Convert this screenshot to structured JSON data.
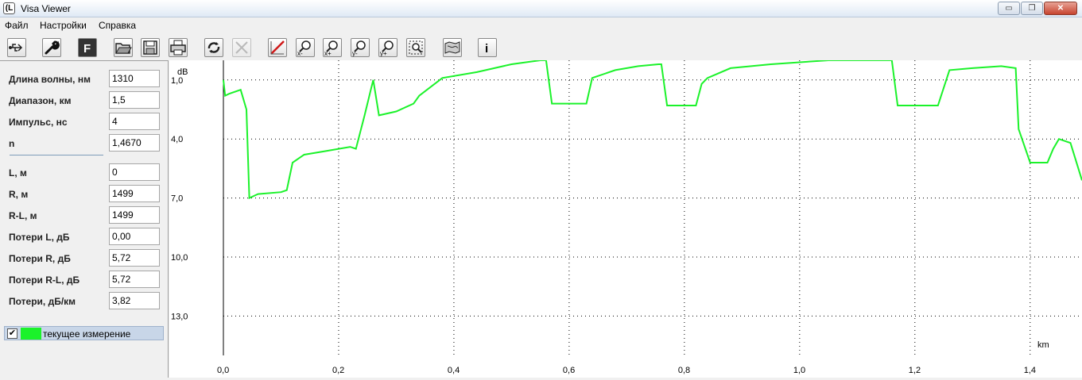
{
  "window": {
    "title": "Visa Viewer",
    "icon_glyph": "(L"
  },
  "window_controls": {
    "minimize": "▭",
    "maximize": "❐",
    "close": "✕"
  },
  "menu": {
    "items": [
      "Файл",
      "Настройки",
      "Справка"
    ]
  },
  "toolbar": {
    "buttons": [
      {
        "icon": "usb-icon"
      },
      {
        "icon": "wrench-icon"
      },
      {
        "icon": "f-icon",
        "label": "F"
      },
      {
        "icon": "folder-open-icon"
      },
      {
        "icon": "save-icon"
      },
      {
        "icon": "print-icon"
      },
      {
        "icon": "refresh-icon"
      },
      {
        "icon": "close-icon",
        "disabled": true
      },
      {
        "icon": "marker-icon"
      },
      {
        "icon": "zoom-x-out-icon",
        "label": "x-"
      },
      {
        "icon": "zoom-x-in-icon",
        "label": "x+"
      },
      {
        "icon": "zoom-y-out-icon",
        "label": "y-"
      },
      {
        "icon": "zoom-y-in-icon",
        "label": "y+"
      },
      {
        "icon": "zoom-fit-icon"
      },
      {
        "icon": "map-icon"
      },
      {
        "icon": "info-icon",
        "label": "i"
      }
    ]
  },
  "params": {
    "wavelength": {
      "label": "Длина волны, нм",
      "value": "1310"
    },
    "range": {
      "label": "Диапазон, км",
      "value": "1,5"
    },
    "pulse": {
      "label": "Импульс, нс",
      "value": "4"
    },
    "n": {
      "label": "n",
      "value": "1,4670"
    },
    "L": {
      "label": "L, м",
      "value": "0"
    },
    "R": {
      "label": "R, м",
      "value": "1499"
    },
    "RL": {
      "label": "R-L, м",
      "value": "1499"
    },
    "lossL": {
      "label": "Потери L, дБ",
      "value": "0,00"
    },
    "lossR": {
      "label": "Потери R, дБ",
      "value": "5,72"
    },
    "lossRL": {
      "label": "Потери R-L, дБ",
      "value": "5,72"
    },
    "lossPerKm": {
      "label": "Потери, дБ/км",
      "value": "3,82"
    }
  },
  "legend": {
    "label": "текущее измерение",
    "checked": "✔",
    "color": "#1bf22a"
  },
  "chart_data": {
    "type": "line",
    "xlabel": "km",
    "ylabel": "dB",
    "x_ticks": [
      "0,0",
      "0,2",
      "0,4",
      "0,6",
      "0,8",
      "1,0",
      "1,2",
      "1,4"
    ],
    "y_ticks": [
      "1,0",
      "4,0",
      "7,0",
      "10,0",
      "13,0"
    ],
    "xlim": [
      0,
      1.49
    ],
    "ylim": [
      0,
      15
    ],
    "y_inverted": true,
    "grid": true,
    "series": [
      {
        "color": "#1bf22a",
        "x": [
          0.0,
          0.003,
          0.01,
          0.03,
          0.04,
          0.045,
          0.06,
          0.1,
          0.11,
          0.12,
          0.14,
          0.18,
          0.22,
          0.23,
          0.245,
          0.255,
          0.26,
          0.27,
          0.3,
          0.33,
          0.34,
          0.38,
          0.44,
          0.5,
          0.55,
          0.56,
          0.57,
          0.6,
          0.62,
          0.63,
          0.64,
          0.68,
          0.72,
          0.755,
          0.76,
          0.77,
          0.8,
          0.82,
          0.83,
          0.84,
          0.88,
          0.95,
          1.0,
          1.05,
          1.1,
          1.15,
          1.16,
          1.17,
          1.2,
          1.23,
          1.24,
          1.26,
          1.3,
          1.35,
          1.375,
          1.38,
          1.4,
          1.43,
          1.44,
          1.45,
          1.47,
          1.49
        ],
        "y": [
          1.0,
          1.8,
          1.7,
          1.5,
          2.5,
          7.0,
          6.8,
          6.7,
          6.6,
          5.2,
          4.8,
          4.6,
          4.4,
          4.5,
          2.8,
          1.6,
          1.0,
          2.8,
          2.6,
          2.2,
          1.8,
          0.9,
          0.6,
          0.2,
          0.0,
          0.0,
          2.2,
          2.2,
          2.2,
          2.2,
          0.9,
          0.5,
          0.3,
          0.2,
          0.2,
          2.3,
          2.3,
          2.3,
          1.2,
          0.9,
          0.4,
          0.2,
          0.1,
          0.0,
          0.0,
          0.0,
          0.0,
          2.3,
          2.3,
          2.3,
          2.3,
          0.5,
          0.4,
          0.3,
          0.4,
          3.5,
          5.2,
          5.2,
          4.5,
          4.0,
          4.2,
          6.1
        ]
      }
    ]
  }
}
